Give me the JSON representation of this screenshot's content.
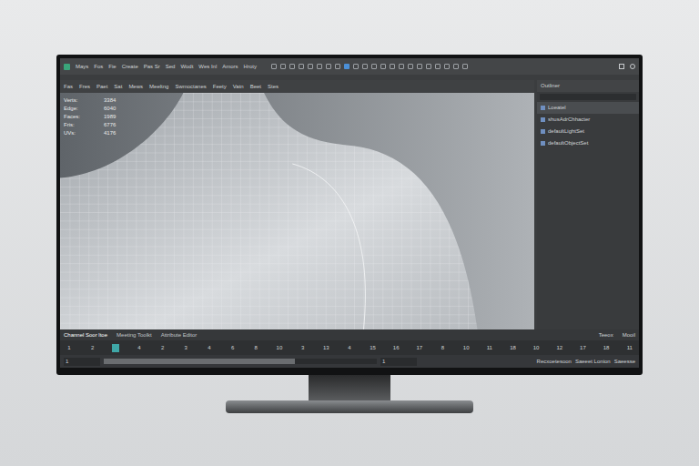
{
  "menu_bar": {
    "items": [
      "Mays",
      "Fos",
      "Fie",
      "Create",
      "Pas Sr",
      "Sed",
      "Wodt",
      "Wes Inl",
      "Amors",
      "Hroty"
    ]
  },
  "viewport_menu": [
    "Fas",
    "Fres",
    "Paet",
    "Sat",
    "Mews",
    "Meeltng",
    "Swmoctanes",
    "Feety",
    "Vatn",
    "Beet",
    "Stes"
  ],
  "hud": [
    {
      "label": "Verts:",
      "value": "3384"
    },
    {
      "label": "Edge:",
      "value": "6040"
    },
    {
      "label": "Faces:",
      "value": "1989"
    },
    {
      "label": "Fris:",
      "value": "6776"
    },
    {
      "label": "UVs:",
      "value": "4176"
    }
  ],
  "outliner": {
    "title": "Outliner",
    "items": [
      {
        "label": "Loeatel",
        "selected": true
      },
      {
        "label": "shusAdrChhacter",
        "selected": false
      },
      {
        "label": "defaultLightSet",
        "selected": false
      },
      {
        "label": "defaultObjectSet",
        "selected": false
      }
    ]
  },
  "bottom_tabs": [
    {
      "label": "Channel Soor ltoe",
      "selected": true
    },
    {
      "label": "Meeting Toolkt",
      "selected": false
    },
    {
      "label": "Attribute Editor",
      "selected": false
    }
  ],
  "bottom_right": [
    "Teeox",
    "Mooil"
  ],
  "timeline": {
    "ticks": [
      {
        "label": "1",
        "selected": false
      },
      {
        "label": "2",
        "selected": false
      },
      {
        "label": "",
        "selected": true
      },
      {
        "label": "4",
        "selected": false
      },
      {
        "label": "2",
        "selected": false
      },
      {
        "label": "3",
        "selected": false
      },
      {
        "label": "4",
        "selected": false
      },
      {
        "label": "6",
        "selected": false
      },
      {
        "label": "8",
        "selected": false
      },
      {
        "label": "10",
        "selected": false
      },
      {
        "label": "3",
        "selected": false
      },
      {
        "label": "13",
        "selected": false
      },
      {
        "label": "4",
        "selected": false
      },
      {
        "label": "15",
        "selected": false
      },
      {
        "label": "16",
        "selected": false
      },
      {
        "label": "17",
        "selected": false
      },
      {
        "label": "8",
        "selected": false
      },
      {
        "label": "10",
        "selected": false
      },
      {
        "label": "11",
        "selected": false
      },
      {
        "label": "18",
        "selected": false
      },
      {
        "label": "10",
        "selected": false
      },
      {
        "label": "12",
        "selected": false
      },
      {
        "label": "17",
        "selected": false
      },
      {
        "label": "18",
        "selected": false
      },
      {
        "label": "11",
        "selected": false
      }
    ]
  },
  "range": {
    "start": "1",
    "end": "1",
    "level": 0.7
  },
  "range_right": [
    "Recxoetesoon",
    "Saeeet Lonion",
    "Saeesse"
  ]
}
